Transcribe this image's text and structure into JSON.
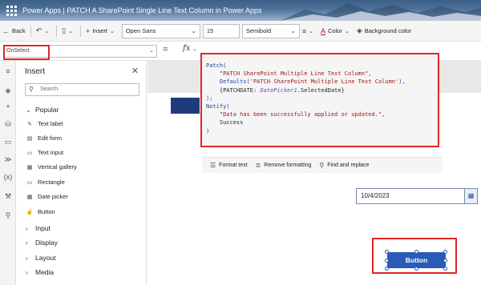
{
  "titlebar": {
    "app": "Power Apps",
    "separator": "|",
    "document_title": "PATCH A SharePoint Single Line Text Column in Power Apps"
  },
  "toolbar": {
    "back_label": "Back",
    "insert_label": "Insert",
    "font_value": "Open Sans",
    "size_value": "15",
    "weight_value": "Semibold",
    "color_label": "Color",
    "background_label": "Background color"
  },
  "formula": {
    "property_value": "OnSelect",
    "equals": "=",
    "fx": "fx"
  },
  "panel": {
    "title": "Insert",
    "search_placeholder": "Search",
    "categories": {
      "popular": "Popular",
      "input": "Input",
      "display": "Display",
      "layout": "Layout",
      "media": "Media"
    },
    "items": [
      "Text label",
      "Edit form",
      "Text input",
      "Vertical gallery",
      "Rectangle",
      "Date picker",
      "Button"
    ]
  },
  "code": {
    "l1": "Patch(",
    "l2": "\"PATCH SharePoint Multiple Line Text Column\",",
    "l3a": "Defaults(",
    "l3b": "'PATCH SharePoint Multiple Line Text Column'",
    "l3c": "),",
    "l4a": "{PATCHDATE: ",
    "l4b": "DatePicker1",
    "l4c": ".SelectedDate}",
    "l5": ");",
    "l6": "Notify(",
    "l7": "\"Data has been successfully applied or updated.\",",
    "l8": "Success",
    "l9": ")"
  },
  "formatbar": {
    "format_text": "Format text",
    "remove_formatting": "Remove formatting",
    "find_replace": "Find and replace"
  },
  "canvas": {
    "date_value": "10/4/2023",
    "button_label": "Button"
  },
  "colors": {
    "accent": "#2b5ab8",
    "highlight": "#e02727"
  }
}
